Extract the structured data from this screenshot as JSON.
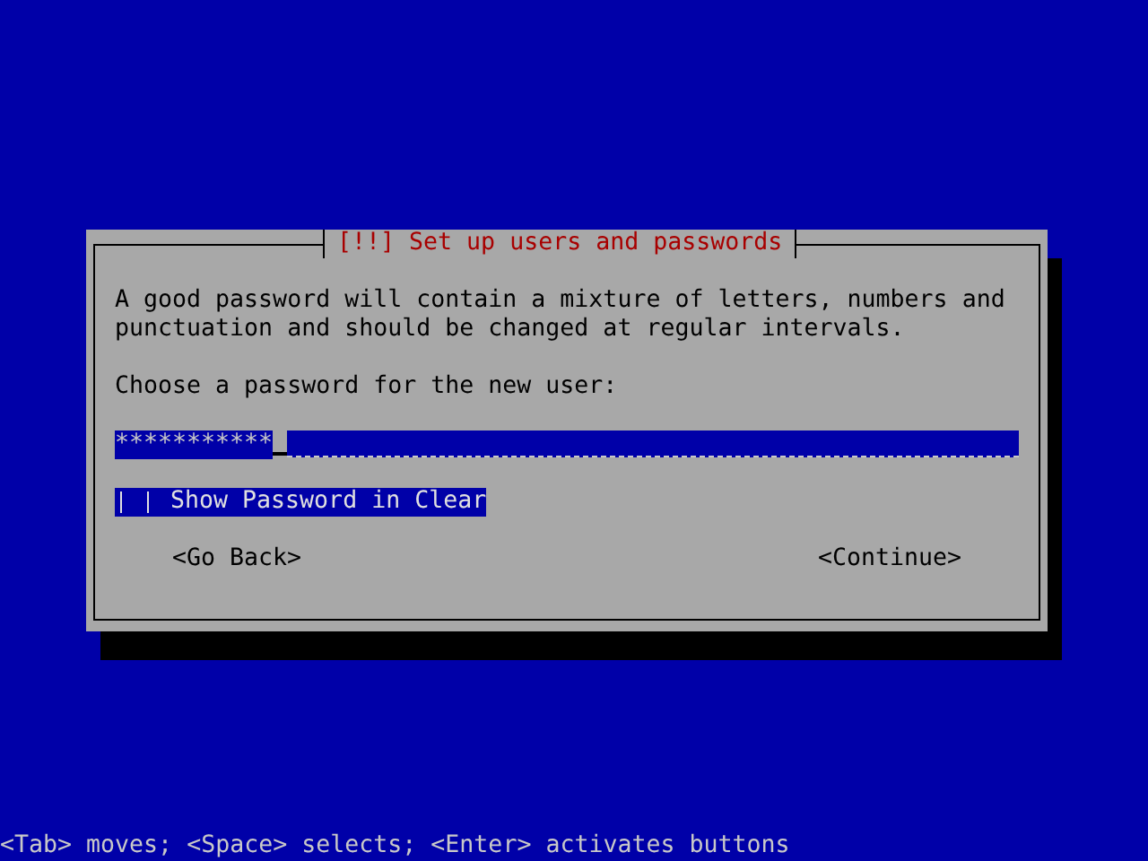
{
  "dialog": {
    "title": "[!!] Set up users and passwords",
    "message": "A good password will contain a mixture of letters, numbers and punctuation and should be changed at regular intervals.",
    "prompt": "Choose a password for the new user:",
    "password_field": {
      "value": "***********",
      "focused": false
    },
    "checkbox": {
      "label": "Show Password in Clear",
      "checked": false,
      "focused": true
    },
    "buttons": [
      {
        "label": "<Go Back>",
        "focused": false
      },
      {
        "label": "<Continue>",
        "focused": false
      }
    ]
  },
  "status_bar": "<Tab> moves; <Space> selects; <Enter> activates buttons"
}
